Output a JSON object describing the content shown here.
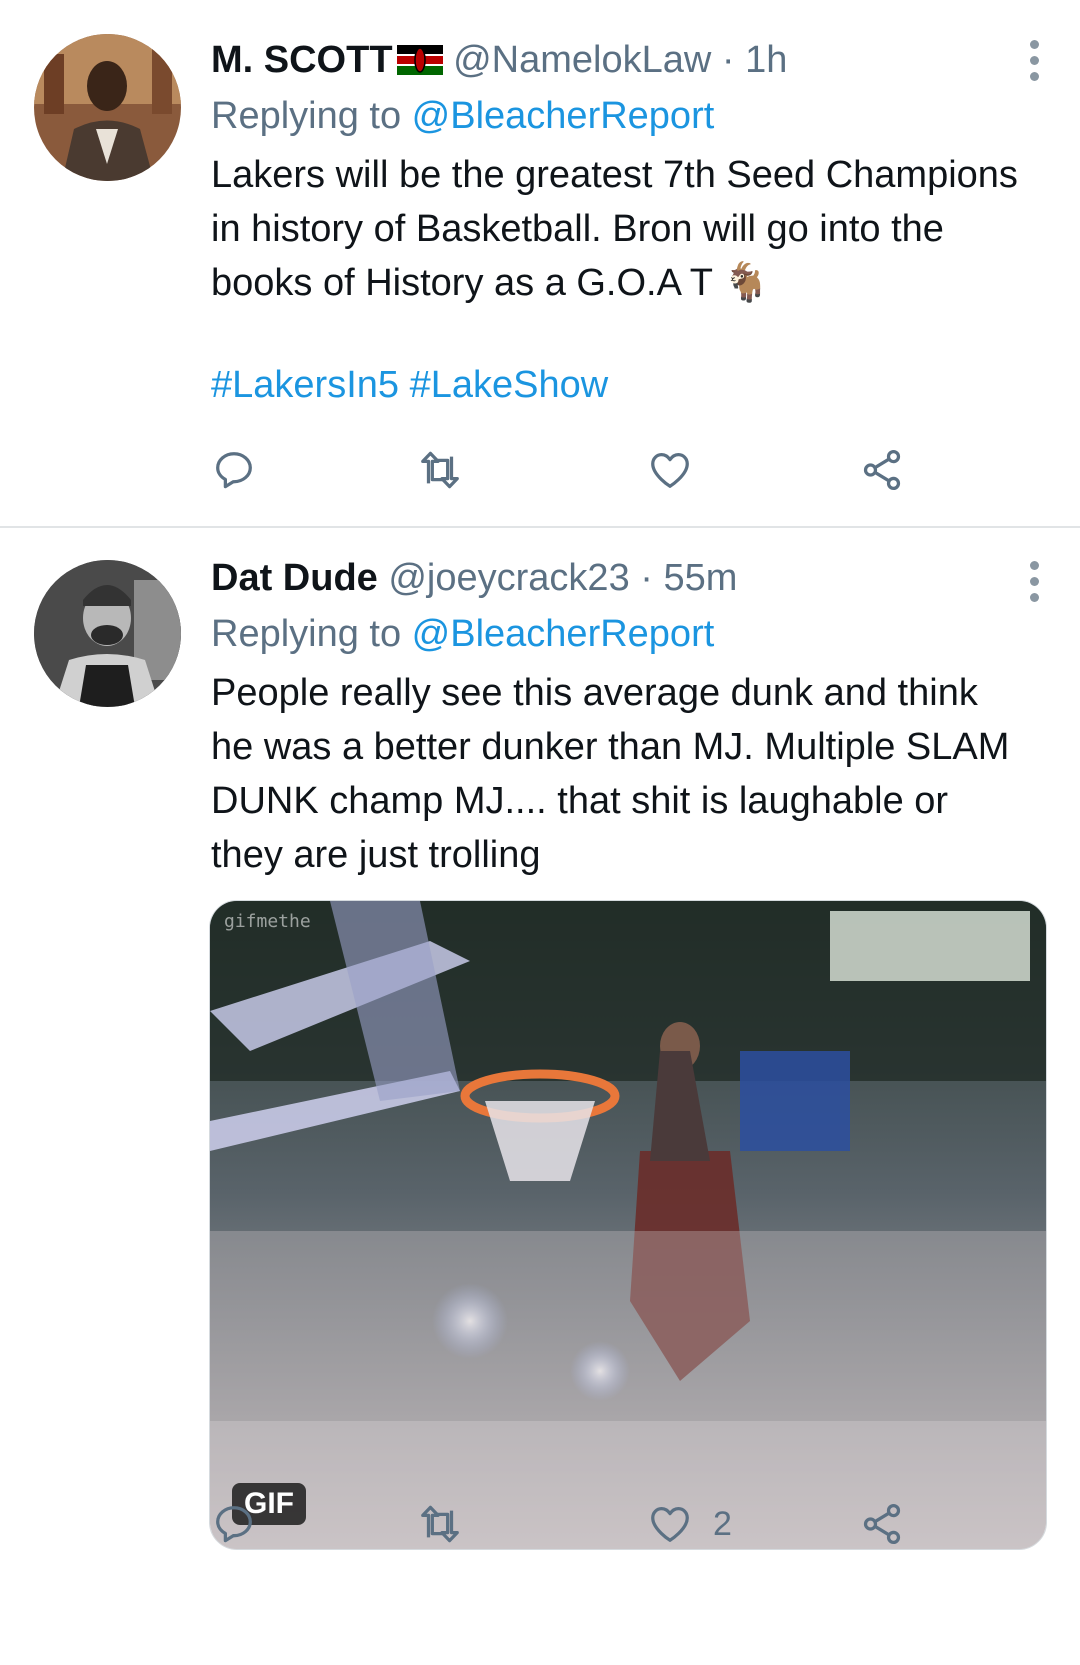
{
  "tweets": [
    {
      "display_name": "M. SCOTT",
      "flag_icon": "kenya-flag-icon",
      "handle": "@NamelokLaw",
      "separator": " · ",
      "time": "1h",
      "replying_prefix": "Replying to ",
      "replying_to": "@BleacherReport",
      "text": "Lakers will be the greatest 7th Seed Champions in history of Basketball. Bron will go into the books of History as a G.O.A T 🐐",
      "hashtags": "#LakersIn5 #LakeShow",
      "actions": {
        "reply_count": "",
        "retweet_count": "",
        "like_count": ""
      }
    },
    {
      "display_name": "Dat Dude",
      "handle": "@joeycrack23",
      "separator": " · ",
      "time": "55m",
      "replying_prefix": "Replying to ",
      "replying_to": "@BleacherReport",
      "text": "People really see this average dunk and think he was a better dunker than MJ. Multiple SLAM DUNK champ MJ.... that shit is laughable or they are just trolling",
      "media": {
        "badge": "GIF",
        "watermark": "gifmethe"
      },
      "actions": {
        "reply_count": "",
        "retweet_count": "",
        "like_count": "2"
      }
    }
  ],
  "colors": {
    "link": "#1b95e0",
    "secondary_text": "#5b7083",
    "primary_text": "#0f1419",
    "divider": "#e1e4e6"
  }
}
